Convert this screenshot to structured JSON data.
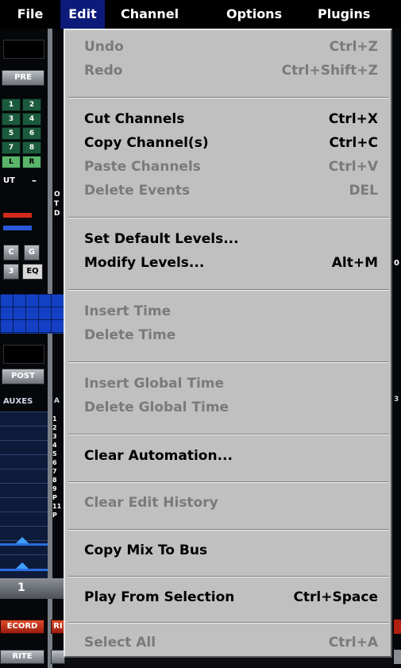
{
  "menubar": {
    "file": "File",
    "edit": "Edit",
    "channel": "Channel",
    "options": "Options",
    "plugins": "Plugins"
  },
  "background": {
    "pre": "PRE",
    "ch_buttons": [
      "1",
      "2",
      "3",
      "4",
      "5",
      "6",
      "7",
      "8",
      "L",
      "R"
    ],
    "out": "UT",
    "minus": "–",
    "eq_c": "C",
    "eq_g": "G",
    "eq_3": "3",
    "eq": "EQ",
    "post": "POST",
    "auxes": "AUXES",
    "aux_numbers": [
      "1",
      "2",
      "3",
      "4",
      "5",
      "6",
      "7",
      "8",
      "9",
      "P",
      "11",
      "P"
    ],
    "ch_num": "1",
    "record": "ECORD",
    "rec_r": "RI",
    "write": "RITE",
    "mid_o": "O",
    "mid_t": "T",
    "mid_d": "D",
    "mid_a": "A",
    "mid_1": "1",
    "right_o": "0",
    "right_3": "3"
  },
  "edit_menu": {
    "items": [
      {
        "label": "Undo",
        "shortcut": "Ctrl+Z",
        "enabled": false
      },
      {
        "label": "Redo",
        "shortcut": "Ctrl+Shift+Z",
        "enabled": false
      },
      {
        "label": "Cut Channels",
        "shortcut": "Ctrl+X",
        "enabled": true
      },
      {
        "label": "Copy Channel(s)",
        "shortcut": "Ctrl+C",
        "enabled": true
      },
      {
        "label": "Paste Channels",
        "shortcut": "Ctrl+V",
        "enabled": false
      },
      {
        "label": "Delete Events",
        "shortcut": "DEL",
        "enabled": false
      },
      {
        "label": "Set Default Levels...",
        "shortcut": "",
        "enabled": true
      },
      {
        "label": "Modify Levels...",
        "shortcut": "Alt+M",
        "enabled": true
      },
      {
        "label": "Insert Time",
        "shortcut": "",
        "enabled": false
      },
      {
        "label": "Delete Time",
        "shortcut": "",
        "enabled": false
      },
      {
        "label": "Insert Global Time",
        "shortcut": "",
        "enabled": false
      },
      {
        "label": "Delete Global Time",
        "shortcut": "",
        "enabled": false
      },
      {
        "label": "Clear Automation...",
        "shortcut": "",
        "enabled": true
      },
      {
        "label": "Clear Edit History",
        "shortcut": "",
        "enabled": false
      },
      {
        "label": "Copy Mix To Bus",
        "shortcut": "",
        "enabled": true
      },
      {
        "label": "Play From Selection",
        "shortcut": "Ctrl+Space",
        "enabled": true
      },
      {
        "label": "Select All",
        "shortcut": "Ctrl+A",
        "enabled": false
      }
    ]
  },
  "colors": {
    "menubar_bg": "#000000",
    "menu_active_bg": "#0c1a7a",
    "dropdown_bg": "#c0c0c0",
    "disabled_text": "#7a7a7a",
    "enabled_text": "#000000"
  }
}
